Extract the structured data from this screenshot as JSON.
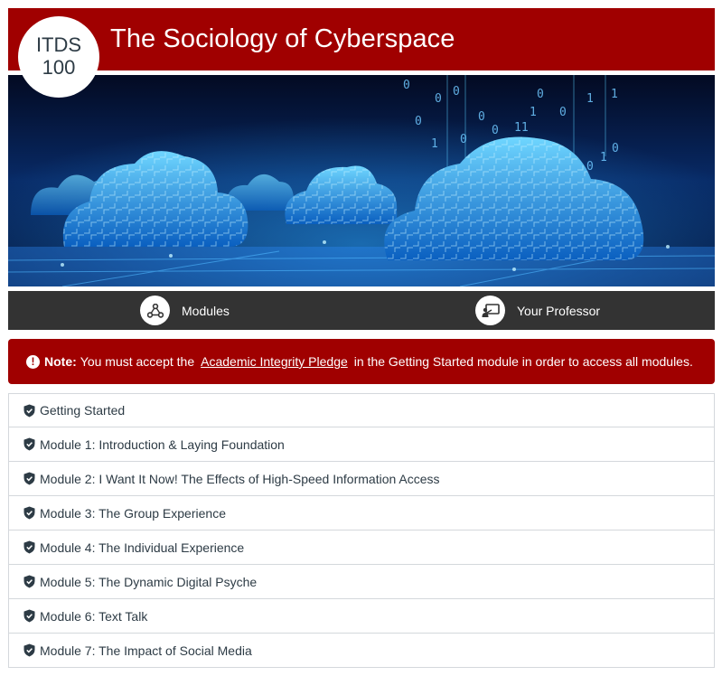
{
  "header": {
    "badge_line1": "ITDS",
    "badge_line2": "100",
    "title": "The Sociology of Cyberspace"
  },
  "nav": {
    "modules_label": "Modules",
    "professor_label": "Your Professor"
  },
  "note": {
    "prefix": "Note:",
    "text_before": "You must accept the",
    "link_text": "Academic Integrity Pledge",
    "text_after": "in the Getting Started module in order to access all modules."
  },
  "modules": [
    {
      "label": "Getting Started"
    },
    {
      "label": "Module 1: Introduction & Laying Foundation"
    },
    {
      "label": "Module 2: I Want It Now! The Effects of High-Speed Information Access"
    },
    {
      "label": "Module 3: The Group Experience"
    },
    {
      "label": "Module 4: The Individual Experience"
    },
    {
      "label": "Module 5: The Dynamic Digital Psyche"
    },
    {
      "label": "Module 6: Text Talk"
    },
    {
      "label": "Module 7: The Impact of Social Media"
    }
  ],
  "icons": {
    "badge": "course-badge",
    "modules": "modules-network-icon",
    "professor": "presenter-icon",
    "note": "exclamation-circle-icon",
    "module_item": "shield-check-icon"
  },
  "colors": {
    "brand_red": "#a00000",
    "nav_dark": "#333333",
    "text": "#2d3b45"
  }
}
